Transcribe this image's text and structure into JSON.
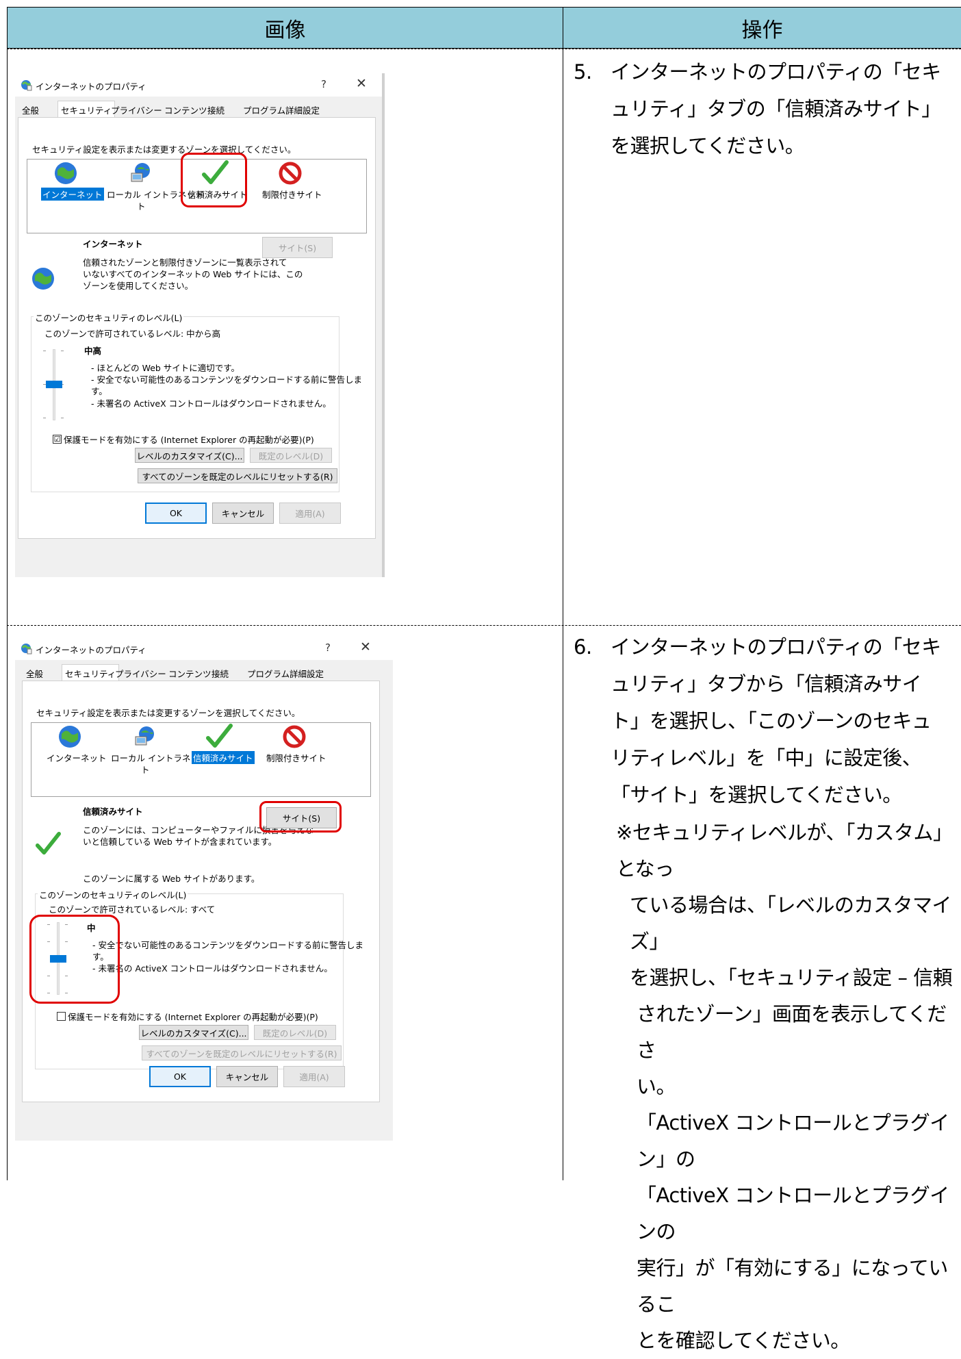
{
  "table": {
    "header": {
      "image_col": "画像",
      "action_col": "操作"
    },
    "rows": [
      {
        "step_num": "5.",
        "step_text": "インターネットのプロパティの「セキュリティ」タブの「信頼済みサイト」を選択してください。"
      },
      {
        "step_num": "6.",
        "step_text": "インターネットのプロパティの「セキュリティ」タブから「信頼済みサイト」を選択し、「このゾーンのセキュリティレベル」を「中」に設定後、「サイト」を選択してください。",
        "note_lines": [
          "※セキュリティレベルが、「カスタム」となっ",
          "ている場合は、「レベルのカスタマイズ」",
          "を選択し、「セキュリティ設定 – 信頼",
          "されたゾーン」画面を表示してくださ",
          "い。",
          "「ActiveX コントロールとプラグイン」の",
          "「ActiveX コントロールとプラグインの",
          "実行」が「有効にする」になっているこ",
          "とを確認してください。"
        ]
      }
    ]
  },
  "dialog1": {
    "title": "インターネットのプロパティ",
    "help": "?",
    "close": "✕",
    "tabs": [
      "全般",
      "セキュリティ",
      "プライバシー",
      "コンテンツ",
      "接続",
      "プログラム",
      "詳細設定"
    ],
    "zone_prompt": "セキュリティ設定を表示または変更するゾーンを選択してください。",
    "zones": [
      "インターネット",
      "ローカル イントラネット",
      "信頼済みサイト",
      "制限付きサイト"
    ],
    "zone_title": "インターネット",
    "zone_desc": [
      "信頼されたゾーンと制限付きゾーンに一覧表示されて",
      "いないすべてのインターネットの Web サイトには、この",
      "ゾーンを使用してください。"
    ],
    "sites_button": "サイト(S)",
    "level_group": "このゾーンのセキュリティのレベル(L)",
    "allowed_level": "このゾーンで許可されているレベル: 中から高",
    "level_name": "中高",
    "level_desc": [
      "- ほとんどの Web サイトに適切です。",
      "- 安全でない可能性のあるコンテンツをダウンロードする前に警告しま",
      "す。",
      "- 未署名の ActiveX コントロールはダウンロードされません。"
    ],
    "protected_mode": "保護モードを有効にする (Internet Explorer の再起動が必要)(P)",
    "protected_checked": "☑",
    "customize_button": "レベルのカスタマイズ(C)...",
    "default_button": "既定のレベル(D)",
    "reset_all_button": "すべてのゾーンを既定のレベルにリセットする(R)",
    "ok": "OK",
    "cancel": "キャンセル",
    "apply": "適用(A)",
    "level_fraction": 0.5
  },
  "dialog2": {
    "title": "インターネットのプロパティ",
    "help": "?",
    "close": "✕",
    "tabs": [
      "全般",
      "セキュリティ",
      "プライバシー",
      "コンテンツ",
      "接続",
      "プログラム",
      "詳細設定"
    ],
    "zone_prompt": "セキュリティ設定を表示または変更するゾーンを選択してください。",
    "zones": [
      "インターネット",
      "ローカル イントラネッ",
      "信頼済みサイト",
      "制限付きサイト"
    ],
    "zone_intranet_wrap": "ト",
    "zone_title": "信頼済みサイト",
    "zone_desc": [
      "このゾーンには、コンピューターやファイルに損害を与えな",
      "いと信頼している Web サイトが含まれています。"
    ],
    "sites_button": "サイト(S)",
    "zone_has_sites": "このゾーンに属する Web サイトがあります。",
    "level_group": "このゾーンのセキュリティのレベル(L)",
    "allowed_level": "このゾーンで許可されているレベル: すべて",
    "level_name": "中",
    "level_desc": [
      "- 安全でない可能性のあるコンテンツをダウンロードする前に警告しま",
      "す。",
      "- 未署名の ActiveX コントロールはダウンロードされません。"
    ],
    "protected_mode": "保護モードを有効にする (Internet Explorer の再起動が必要)(P)",
    "customize_button": "レベルのカスタマイズ(C)...",
    "default_button": "既定のレベル(D)",
    "reset_all_button": "すべてのゾーンを既定のレベルにリセットする(R)",
    "ok": "OK",
    "cancel": "キャンセル",
    "apply": "適用(A)",
    "level_fraction": 0.5
  },
  "dialog1_intranet_wrap": "ト",
  "colors": {
    "header_bg": "#94cddb",
    "highlight_red": "#e00000",
    "selection_blue": "#0078d7"
  }
}
